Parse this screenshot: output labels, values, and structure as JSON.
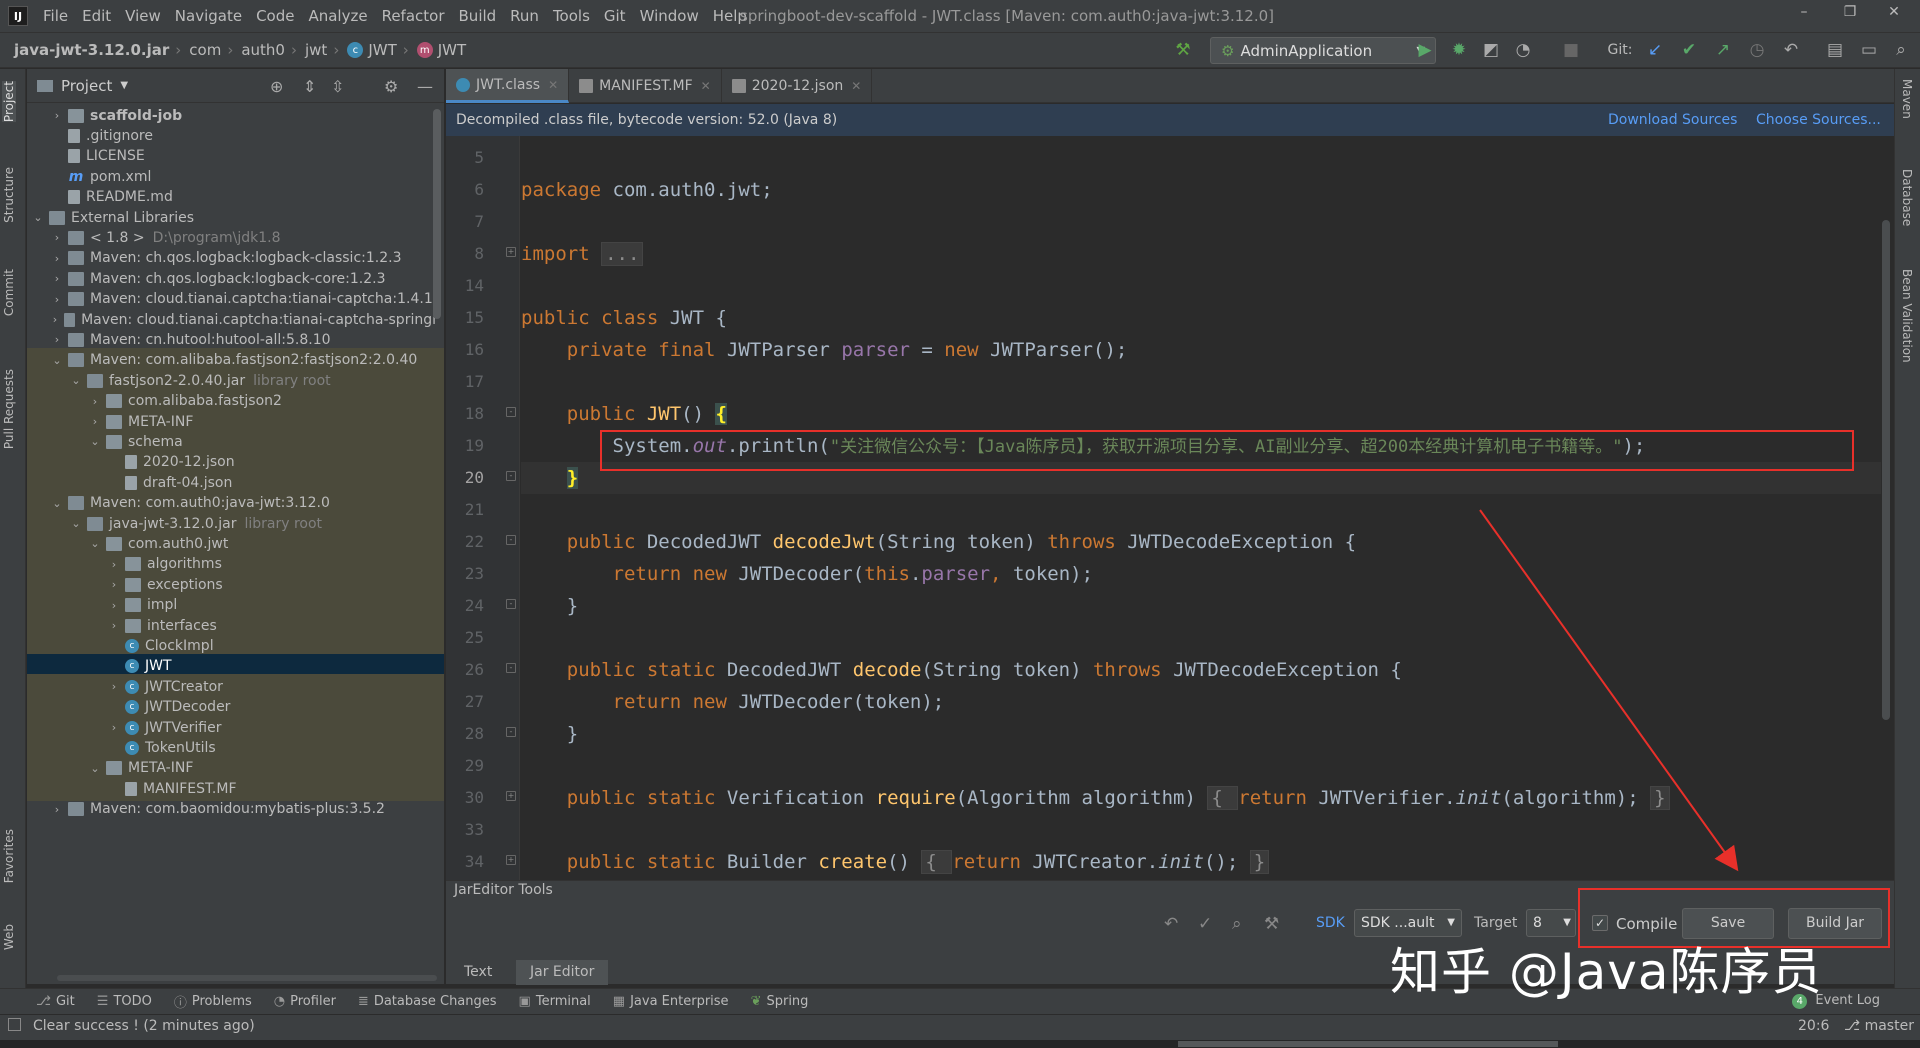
{
  "window": {
    "title": "springboot-dev-scaffold - JWT.class [Maven: com.auth0:java-jwt:3.12.0]",
    "menu": [
      "File",
      "Edit",
      "View",
      "Navigate",
      "Code",
      "Analyze",
      "Refactor",
      "Build",
      "Run",
      "Tools",
      "Git",
      "Window",
      "Help"
    ],
    "controls": [
      "–",
      "❐",
      "✕"
    ]
  },
  "breadcrumb": [
    "java-jwt-3.12.0.jar",
    "com",
    "auth0",
    "jwt",
    "JWT",
    "JWT"
  ],
  "toolbar": {
    "run_config": "AdminApplication",
    "git_label": "Git:"
  },
  "project": {
    "header": "Project",
    "rows": [
      {
        "label": "scaffold-job",
        "muted": ""
      },
      {
        "label": ".gitignore",
        "muted": ""
      },
      {
        "label": "LICENSE",
        "muted": ""
      },
      {
        "label": "pom.xml",
        "muted": ""
      },
      {
        "label": "README.md",
        "muted": ""
      },
      {
        "label": "External Libraries",
        "muted": ""
      },
      {
        "label": "< 1.8 >",
        "muted": "D:\\program\\jdk1.8"
      },
      {
        "label": "Maven: ch.qos.logback:logback-classic:1.2.3",
        "muted": ""
      },
      {
        "label": "Maven: ch.qos.logback:logback-core:1.2.3",
        "muted": ""
      },
      {
        "label": "Maven: cloud.tianai.captcha:tianai-captcha:1.4.1",
        "muted": ""
      },
      {
        "label": "Maven: cloud.tianai.captcha:tianai-captcha-springl",
        "muted": ""
      },
      {
        "label": "Maven: cn.hutool:hutool-all:5.8.10",
        "muted": ""
      },
      {
        "label": "Maven: com.alibaba.fastjson2:fastjson2:2.0.40",
        "muted": ""
      },
      {
        "label": "fastjson2-2.0.40.jar",
        "muted": "library root"
      },
      {
        "label": "com.alibaba.fastjson2",
        "muted": ""
      },
      {
        "label": "META-INF",
        "muted": ""
      },
      {
        "label": "schema",
        "muted": ""
      },
      {
        "label": "2020-12.json",
        "muted": ""
      },
      {
        "label": "draft-04.json",
        "muted": ""
      },
      {
        "label": "Maven: com.auth0:java-jwt:3.12.0",
        "muted": ""
      },
      {
        "label": "java-jwt-3.12.0.jar",
        "muted": "library root"
      },
      {
        "label": "com.auth0.jwt",
        "muted": ""
      },
      {
        "label": "algorithms",
        "muted": ""
      },
      {
        "label": "exceptions",
        "muted": ""
      },
      {
        "label": "impl",
        "muted": ""
      },
      {
        "label": "interfaces",
        "muted": ""
      },
      {
        "label": "ClockImpl",
        "muted": ""
      },
      {
        "label": "JWT",
        "muted": ""
      },
      {
        "label": "JWTCreator",
        "muted": ""
      },
      {
        "label": "JWTDecoder",
        "muted": ""
      },
      {
        "label": "JWTVerifier",
        "muted": ""
      },
      {
        "label": "TokenUtils",
        "muted": ""
      },
      {
        "label": "META-INF",
        "muted": ""
      },
      {
        "label": "MANIFEST.MF",
        "muted": ""
      },
      {
        "label": "Maven: com.baomidou:mybatis-plus:3.5.2",
        "muted": ""
      }
    ]
  },
  "left_tabs": [
    "Project",
    "Structure",
    "Commit",
    "Pull Requests",
    "Favorites",
    "Web"
  ],
  "right_tabs": [
    "Maven",
    "Database",
    "Bean Validation"
  ],
  "editor": {
    "tabs": [
      "JWT.class",
      "MANIFEST.MF",
      "2020-12.json"
    ],
    "banner": "Decompiled .class file, bytecode version: 52.0 (Java 8)",
    "download_sources": "Download Sources",
    "choose_sources": "Choose Sources...",
    "line_numbers": [
      "5",
      "6",
      "7",
      "8",
      "14",
      "15",
      "16",
      "17",
      "18",
      "19",
      "20",
      "21",
      "22",
      "23",
      "24",
      "25",
      "26",
      "27",
      "28",
      "29",
      "30",
      "33",
      "34"
    ],
    "code": {
      "l6_kw": "package",
      "l6_rest": " com.auth0.jwt;",
      "l8_kw": "import",
      "l8_fold": "...",
      "l15_kw": "public class",
      "l15_rest": " JWT {",
      "l16_kw": "    private final",
      "l16_type": " JWTParser ",
      "l16_fld": "parser",
      "l16_eq": " = ",
      "l16_new": "new",
      "l16_rest": " JWTParser();",
      "l18_kw": "    public",
      "l18_fn": " JWT",
      "l18_paren": "() ",
      "l18_brace": "{",
      "l19_pre": "        System.",
      "l19_out": "out",
      "l19_mid": ".println(",
      "l19_str": "\"关注微信公众号：【Java陈序员】，获取开源项目分享、AI副业分享、超200本经典计算机电子书籍等。\"",
      "l19_end": ");",
      "l20_pre": "    ",
      "l20_brace": "}",
      "l22_kw": "    public",
      "l22_type": " DecodedJWT ",
      "l22_fn": "decodeJwt",
      "l22_args": "(String token) ",
      "l22_throws": "throws",
      "l22_rest": " JWTDecodeException {",
      "l23_kw": "        return new",
      "l23_mid": " JWTDecoder(",
      "l23_this": "this",
      "l23_dot": ".",
      "l23_fld": "parser",
      "l23_comma": ",",
      "l23_rest": " token);",
      "l24": "    }",
      "l26_kw": "    public static",
      "l26_type": " DecodedJWT ",
      "l26_fn": "decode",
      "l26_args": "(String token) ",
      "l26_throws": "throws",
      "l26_rest": " JWTDecodeException {",
      "l27_kw": "        return new",
      "l27_rest": " JWTDecoder(token);",
      "l28": "    }",
      "l30_kw": "    public static",
      "l30_type": " Verification ",
      "l30_fn": "require",
      "l30_args": "(Algorithm algorithm) ",
      "l30_ob": "{ ",
      "l30_ret": "return",
      "l30_mid": " JWTVerifier.",
      "l30_init": "init",
      "l30_end": "(algorithm); ",
      "l30_cb": "}",
      "l34_kw": "    public static",
      "l34_type": " Builder ",
      "l34_fn": "create",
      "l34_args": "() ",
      "l34_ob": "{ ",
      "l34_ret": "return",
      "l34_mid": " JWTCreator.",
      "l34_init": "init",
      "l34_end": "(); ",
      "l34_cb": "}"
    }
  },
  "jar_editor": {
    "title": "JarEditor Tools",
    "sdk_label": "SDK",
    "sdk_value": "SDK ...ault",
    "target_label": "Target",
    "target_value": "8",
    "compile_label": "Compile",
    "compile_checked": true,
    "save_label": "Save",
    "build_label": "Build Jar",
    "tabs": [
      "Text",
      "Jar Editor"
    ]
  },
  "tool_windows": [
    "Git",
    "TODO",
    "Problems",
    "Profiler",
    "Database Changes",
    "Terminal",
    "Java Enterprise",
    "Spring"
  ],
  "event_log": {
    "count": "4",
    "label": "Event Log"
  },
  "status": {
    "message": "Clear success ! (2 minutes ago)",
    "position": "20:6",
    "branch": "master"
  },
  "watermark": "知乎 @Java陈序员",
  "colors": {
    "accent_red": "#e8302a",
    "link_blue": "#589df6",
    "keyword": "#cc7832",
    "string": "#6a8759"
  }
}
